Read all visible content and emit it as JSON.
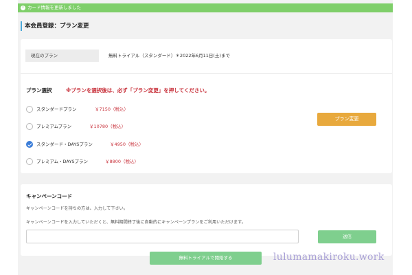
{
  "alert": {
    "message": "カード情報を更新しました",
    "color": "#7fcf6a"
  },
  "page_title": "本会員登録：プラン変更",
  "current_plan": {
    "label": "現在のプラン",
    "value": "無料トライアル（スタンダード）＊2022年6月11日(土)まで"
  },
  "plan_select": {
    "heading": "プラン選択",
    "note": "※プランを選択後は、必ず「プラン変更」を押してください。",
    "options": [
      {
        "name": "スタンダードプラン",
        "price": "￥7150（税込）",
        "checked": false
      },
      {
        "name": "プレミアムプラン",
        "price": "￥10780（税込）",
        "checked": false
      },
      {
        "name": "スタンダード・DAYSプラン",
        "price": "￥4950（税込）",
        "checked": true
      },
      {
        "name": "プレミアム・DAYSプラン",
        "price": "￥8800（税込）",
        "checked": false
      }
    ],
    "change_button": "プラン変更"
  },
  "campaign": {
    "heading": "キャンペーンコード",
    "text1": "キャンペーンコードを持ちの方は、入力して下さい。",
    "text2": "キャンペーンコードを入力していただくと、無料期間終了後に自動的にキャンペーンプランをご利用いただけます。",
    "input_value": "",
    "send_button": "送信"
  },
  "start_button": "無料トライアルで開始する",
  "watermark": "lulumamakiroku.work",
  "colors": {
    "accent_orange": "#e8a93d",
    "accent_green": "#7fcf8e",
    "note_red": "#c8303a",
    "radio_checked": "#3b7dd8"
  }
}
